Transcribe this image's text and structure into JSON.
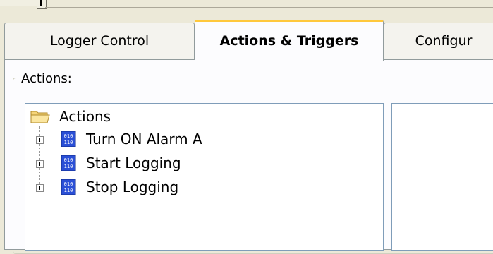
{
  "tabs": [
    {
      "label": "Logger Control",
      "active": false
    },
    {
      "label": "Actions & Triggers",
      "active": true
    },
    {
      "label": "Configur",
      "active": false
    }
  ],
  "group": {
    "label": "Actions:"
  },
  "tree": {
    "root": {
      "label": "Actions",
      "icon": "folder-icon"
    },
    "items": [
      {
        "label": "Turn ON Alarm A",
        "icon": "action-icon"
      },
      {
        "label": "Start Logging",
        "icon": "action-icon"
      },
      {
        "label": "Stop Logging",
        "icon": "action-icon"
      }
    ]
  },
  "colors": {
    "active_tab_accent": "#ffc83c",
    "panel_border": "#7f9db9",
    "dialog_bg": "#ece9d8"
  }
}
